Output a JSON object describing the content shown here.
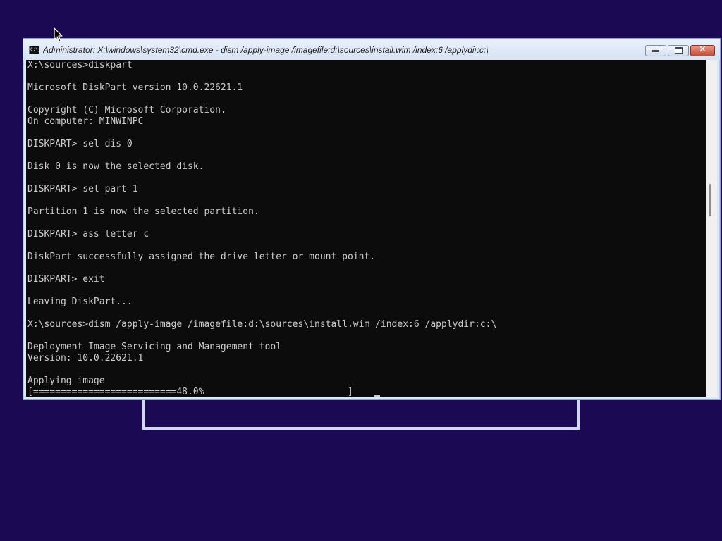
{
  "window": {
    "title": "Administrator: X:\\windows\\system32\\cmd.exe - dism  /apply-image /imagefile:d:\\sources\\install.wim /index:6 /applydir:c:\\",
    "icon": "cmd-icon",
    "icon_text": "C:\\_",
    "buttons": {
      "minimize": "minimize-icon",
      "maximize": "maximize-icon",
      "close": "close-icon",
      "close_glyph": "✕"
    }
  },
  "console": {
    "lines": [
      "X:\\sources>diskpart",
      "",
      "Microsoft DiskPart version 10.0.22621.1",
      "",
      "Copyright (C) Microsoft Corporation.",
      "On computer: MINWINPC",
      "",
      "DISKPART> sel dis 0",
      "",
      "Disk 0 is now the selected disk.",
      "",
      "DISKPART> sel part 1",
      "",
      "Partition 1 is now the selected partition.",
      "",
      "DISKPART> ass letter c",
      "",
      "DiskPart successfully assigned the drive letter or mount point.",
      "",
      "DISKPART> exit",
      "",
      "Leaving DiskPart...",
      "",
      "X:\\sources>dism /apply-image /imagefile:d:\\sources\\install.wim /index:6 /applydir:c:\\",
      "",
      "Deployment Image Servicing and Management tool",
      "Version: 10.0.22621.1",
      "",
      "Applying image"
    ],
    "progress_text": "[==========================48.0%                          ]",
    "progress_percent": 48.0
  },
  "colors": {
    "desktop": "#1b0a53",
    "console_bg": "#0c0c0c",
    "console_fg": "#cccccc"
  }
}
